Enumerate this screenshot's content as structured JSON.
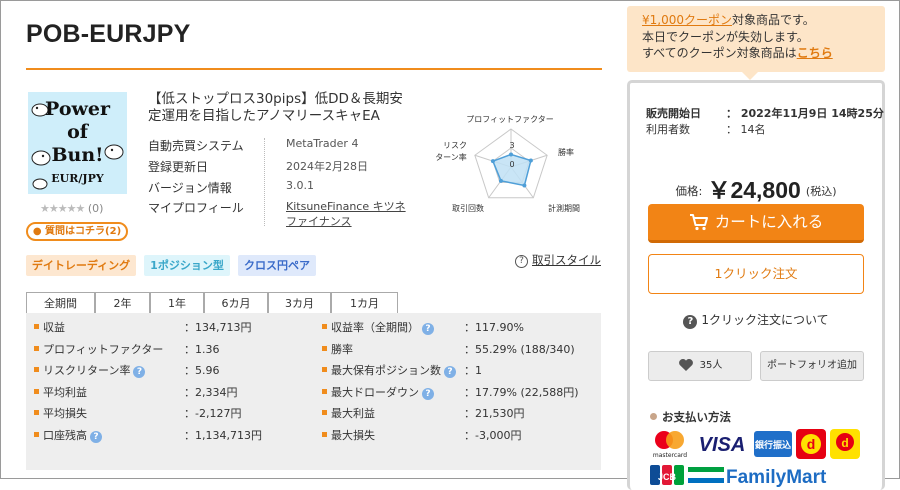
{
  "product": {
    "title": "POB-EURJPY",
    "thumbnail": {
      "line1": "Power",
      "line2": "of",
      "line3": "Bun!",
      "line4": "EUR/JPY"
    },
    "rating": {
      "stars": "★★★★★",
      "count": "(0)"
    },
    "qa_button": "質問はコチラ(2)",
    "description": "【低ストップロス30pips】低DD＆長期安定運用を目指したアノマリースキャEA"
  },
  "specs": [
    {
      "key": "自動売買システム",
      "value": "MetaTrader 4"
    },
    {
      "key": "登録更新日",
      "value": "2024年2月28日"
    },
    {
      "key": "バージョン情報",
      "value": "3.0.1"
    },
    {
      "key": "マイプロフィール",
      "value": "KitsuneFinance キツネファイナンス"
    }
  ],
  "radar": {
    "axes": [
      "プロフィットファクター",
      "勝率",
      "計測期間",
      "取引回数",
      "リスクリターン率"
    ],
    "axis_label_risk_line1": "リスク",
    "axis_label_risk_line2": "ターン率",
    "scale_max_label": "3",
    "scale_min_label": "0",
    "values": [
      0.33,
      0.55,
      0.6,
      0.45,
      0.5
    ],
    "colors": {
      "fill": "#bfe0f5",
      "stroke": "#4f9fd8",
      "grid": "#c8c8c8"
    }
  },
  "tags": [
    "デイトレーディング",
    "1ポジション型",
    "クロス円ペア"
  ],
  "trade_style_link": "取引スタイル",
  "tabs": [
    "全期間",
    "2年",
    "1年",
    "6カ月",
    "3カ月",
    "1カ月"
  ],
  "stats_left": [
    {
      "key": "収益",
      "value": "：134,713円",
      "help": false
    },
    {
      "key": "プロフィットファクター",
      "value": "：1.36",
      "help": false
    },
    {
      "key": "リスクリターン率",
      "value": "：5.96",
      "help": true
    },
    {
      "key": "平均利益",
      "value": "：2,334円",
      "help": false
    },
    {
      "key": "平均損失",
      "value": "：-2,127円",
      "help": false
    },
    {
      "key": "口座残高",
      "value": "：1,134,713円",
      "help": true
    }
  ],
  "stats_right": [
    {
      "key": "収益率（全期間）",
      "value": "：117.90%",
      "help": true
    },
    {
      "key": "勝率",
      "value": "：55.29% (188/340)",
      "help": false
    },
    {
      "key": "最大保有ポジション数",
      "value": "：1",
      "help": true
    },
    {
      "key": "最大ドローダウン",
      "value": "：17.79% (22,588円)",
      "help": true
    },
    {
      "key": "最大利益",
      "value": "：21,530円",
      "help": false
    },
    {
      "key": "最大損失",
      "value": "：-3,000円",
      "help": false
    }
  ],
  "coupon": {
    "link_text": "¥1,000クーポン",
    "line1_rest": "対象商品です。",
    "line2": "本日でクーポンが失効します。",
    "line3_prefix": "すべてのクーポン対象商品は",
    "line3_link": "こちら"
  },
  "sale": {
    "start_label": "販売開始日",
    "start_value": "：  2022年11月9日  14時25分",
    "users_label": "利用者数",
    "users_value": "：  14名",
    "price_label": "価格:",
    "price_value": "￥24,800",
    "tax_label": "(税込)",
    "cart_button": "カートに入れる",
    "one_click_button": "1クリック注文",
    "one_click_info": "1クリック注文について",
    "fav_count": "35人",
    "portfolio_button": "ポートフォリオ追加",
    "payment_title": "お支払い方法"
  },
  "payment_logos": {
    "visa": "VISA",
    "bank": "銀行振込",
    "familymart": "FamilyMart",
    "mastercard": "mastercard",
    "jcb": "JCB"
  },
  "colors": {
    "accent_orange": "#f28415",
    "coupon_bg": "#fde5c8",
    "stat_bg": "#eeeeee"
  }
}
